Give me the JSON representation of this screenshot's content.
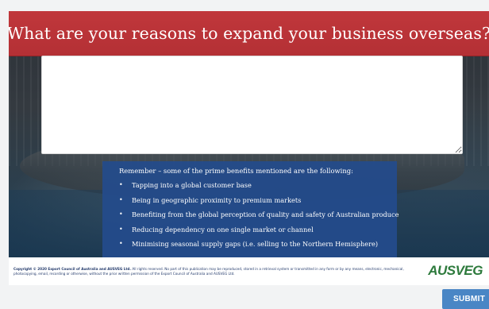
{
  "slide": {
    "title": "What are your reasons to expand your business overseas?",
    "answer_box": {
      "value": ""
    },
    "benefits": {
      "intro": "Remember – some of the prime benefits mentioned are the following:",
      "items": [
        "Tapping into a global customer base",
        "Being in geographic proximity to premium markets",
        "Benefiting from the global perception of quality and safety of Australian produce",
        "Reducing dependency on one single market or channel",
        "Minimising seasonal supply gaps (i.e. selling to the Northern Hemisphere)"
      ]
    },
    "footer": {
      "copyright_lead": "Copyright © 2020 Export Council of Australia and AUSVEG Ltd.",
      "copyright_rest": " All rights reserved. No part of this publication may be reproduced, stored in a retrieval system or transmitted in any form or by any means, electronic, mechanical, photocopying, email, recording or otherwise, without the prior written permission of the Export Council of Australia and AUSVEG Ltd.",
      "logo_text": "AUSVEG"
    }
  },
  "submit_label": "SUBMIT",
  "colors": {
    "title_banner": "#b43035",
    "benefits_panel": "#234b8c",
    "submit_button": "#4a86c5",
    "logo_green": "#2d7a3c"
  },
  "icons": {
    "bullet": "•"
  }
}
